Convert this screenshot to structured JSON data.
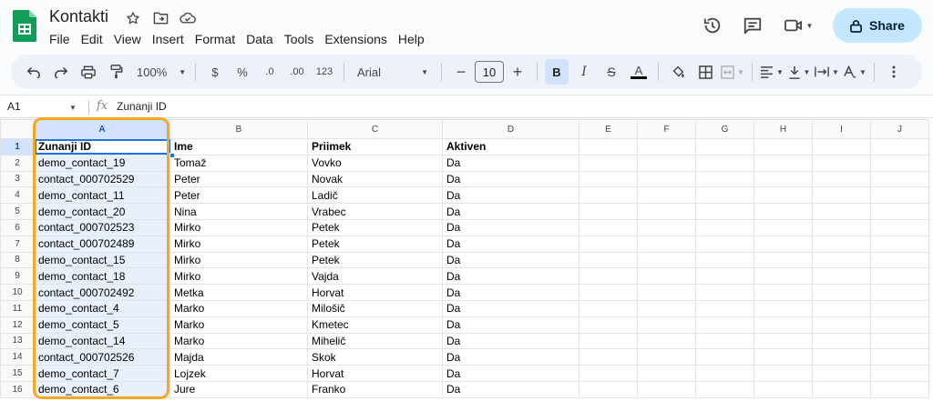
{
  "doc": {
    "title": "Kontakti"
  },
  "menu": [
    "File",
    "Edit",
    "View",
    "Insert",
    "Format",
    "Data",
    "Tools",
    "Extensions",
    "Help"
  ],
  "share": {
    "label": "Share"
  },
  "toolbar": {
    "zoom": "100%",
    "currency": "$",
    "percent": "%",
    "dec_decrease": ".0",
    "dec_increase": ".00",
    "format_123": "123",
    "font": "Arial",
    "font_size": "10",
    "bold": "B",
    "italic": "I",
    "strike": "S",
    "text_color": "A"
  },
  "formula_bar": {
    "cell_ref": "A1",
    "fx": "fx",
    "content": "Zunanji ID"
  },
  "columns": [
    "A",
    "B",
    "C",
    "D",
    "E",
    "F",
    "G",
    "H",
    "I",
    "J"
  ],
  "rows": [
    {
      "n": "1",
      "cells": [
        "Zunanji ID",
        "Ime",
        "Priimek",
        "Aktiven"
      ]
    },
    {
      "n": "2",
      "cells": [
        "demo_contact_19",
        "Tomaž",
        "Vovko",
        "Da"
      ]
    },
    {
      "n": "3",
      "cells": [
        "contact_000702529",
        "Peter",
        "Novak",
        "Da"
      ]
    },
    {
      "n": "4",
      "cells": [
        "demo_contact_11",
        "Peter",
        "Ladič",
        "Da"
      ]
    },
    {
      "n": "5",
      "cells": [
        "demo_contact_20",
        "Nina",
        "Vrabec",
        "Da"
      ]
    },
    {
      "n": "6",
      "cells": [
        "contact_000702523",
        "Mirko",
        "Petek",
        "Da"
      ]
    },
    {
      "n": "7",
      "cells": [
        "contact_000702489",
        "Mirko",
        "Petek",
        "Da"
      ]
    },
    {
      "n": "8",
      "cells": [
        "demo_contact_15",
        "Mirko",
        "Petek",
        "Da"
      ]
    },
    {
      "n": "9",
      "cells": [
        "demo_contact_18",
        "Mirko",
        "Vajda",
        "Da"
      ]
    },
    {
      "n": "10",
      "cells": [
        "contact_000702492",
        "Metka",
        "Horvat",
        "Da"
      ]
    },
    {
      "n": "11",
      "cells": [
        "demo_contact_4",
        "Marko",
        "Milošič",
        "Da"
      ]
    },
    {
      "n": "12",
      "cells": [
        "demo_contact_5",
        "Marko",
        "Kmetec",
        "Da"
      ]
    },
    {
      "n": "13",
      "cells": [
        "demo_contact_14",
        "Marko",
        "Mihelič",
        "Da"
      ]
    },
    {
      "n": "14",
      "cells": [
        "contact_000702526",
        "Majda",
        "Skok",
        "Da"
      ]
    },
    {
      "n": "15",
      "cells": [
        "demo_contact_7",
        "Lojzek",
        "Horvat",
        "Da"
      ]
    },
    {
      "n": "16",
      "cells": [
        "demo_contact_6",
        "Jure",
        "Franko",
        "Da"
      ]
    }
  ],
  "colors": {
    "accent": "#1a73e8",
    "highlight": "#f5a623",
    "share_bg": "#c2e7ff",
    "sheets_green": "#0f9d58"
  },
  "icons": [
    "sheets-logo-icon",
    "star-icon",
    "move-folder-icon",
    "cloud-status-icon",
    "history-icon",
    "comment-icon",
    "meet-icon",
    "lock-icon"
  ]
}
